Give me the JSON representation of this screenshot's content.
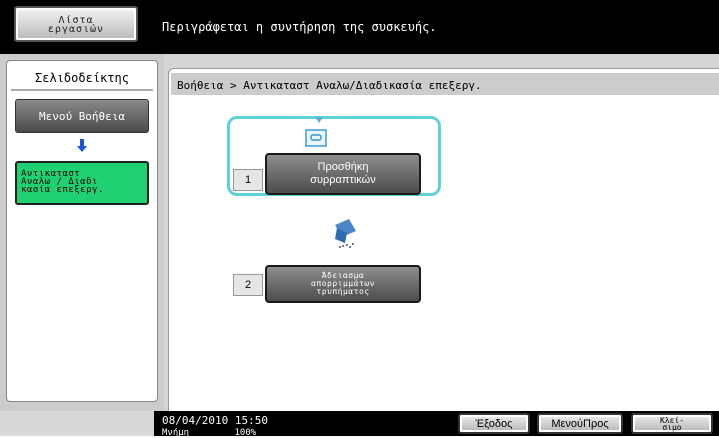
{
  "header": {
    "jobs_button_line1": "Λίστα",
    "jobs_button_line2": "εργασιών",
    "message": "Περιγράφεται η συντήρηση της συσκευής."
  },
  "sidebar": {
    "title": "Σελιδοδείκτης",
    "help_menu_label": "Μενού Βοήθεια",
    "current_item_line1": "Αντικαταστ",
    "current_item_line2": "Αναλω / Διαδι",
    "current_item_line3": "κασία επεξεργ."
  },
  "main": {
    "breadcrumb": "Βοήθεια > Αντικαταστ Αναλω/Διαδικασία επεξεργ.",
    "steps": [
      {
        "number": "1",
        "line1": "Προσθήκη",
        "line2": "συρραπτικών",
        "icon": "staple-icon"
      },
      {
        "number": "2",
        "line1": "Άδειασμα",
        "line2": "απορριμμάτων",
        "line3": "τρυπήματος",
        "icon": "punch-waste-icon"
      }
    ]
  },
  "footer": {
    "datetime": "08/04/2010    15:50",
    "memory_label": "Μνήμη",
    "memory_value": "100%",
    "exit_label": "Έξοδος",
    "menu_label": "ΜενούΠρος",
    "close_line1": "Κλεί-",
    "close_line2": "σιμο"
  },
  "colors": {
    "highlight": "#5ed2d8",
    "current_item": "#1fd172",
    "arrow": "#1a55d8"
  }
}
